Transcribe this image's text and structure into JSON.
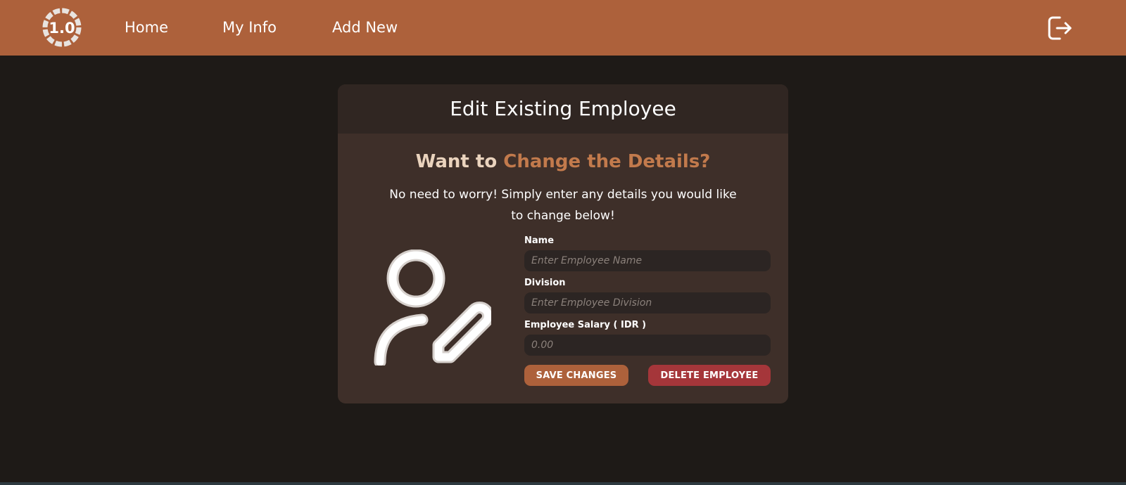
{
  "nav": {
    "logo_text": "1.0",
    "links": [
      "Home",
      "My Info",
      "Add New"
    ],
    "logout_icon": "logout-icon"
  },
  "card": {
    "title": "Edit Existing Employee",
    "headline_part1": "Want to ",
    "headline_part2": "Change the Details?",
    "subtext": "No need to worry! Simply enter any details you would like to change below!",
    "avatar_icon": "user-edit-icon"
  },
  "form": {
    "name_label": "Name",
    "name_placeholder": "Enter Employee Name",
    "name_value": "",
    "division_label": "Division",
    "division_placeholder": "Enter Employee Division",
    "division_value": "",
    "salary_label": "Employee Salary ( IDR )",
    "salary_placeholder": "0.00",
    "salary_value": "",
    "save_label": "SAVE CHANGES",
    "delete_label": "DELETE EMPLOYEE"
  },
  "colors": {
    "navbar": "#ad613b",
    "background": "#1e1a17",
    "card": "#3e2f29",
    "card_header": "#302622",
    "accent": "#c27a4c",
    "headline_light": "#ead3bd",
    "save_button": "#ad613b",
    "delete_button": "#a5363a"
  }
}
